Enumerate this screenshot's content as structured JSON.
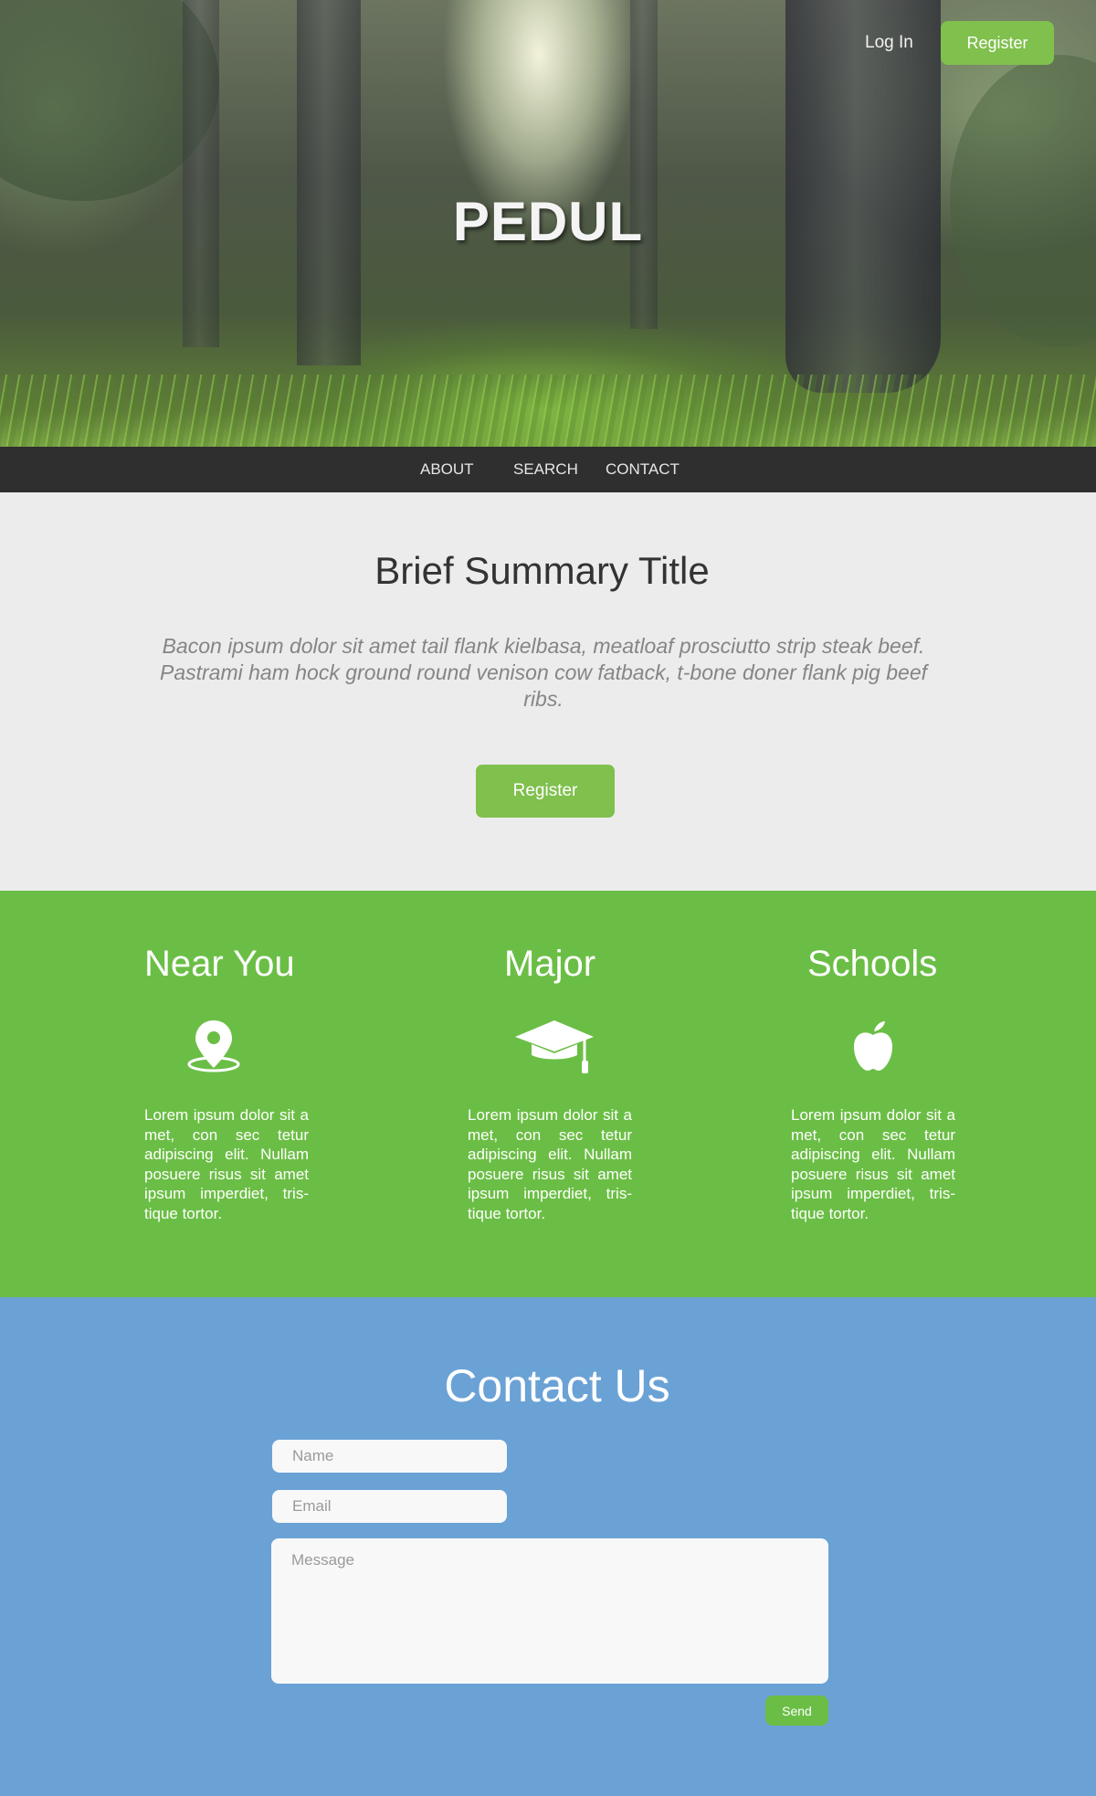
{
  "header": {
    "site_title": "PEDUL",
    "login_label": "Log In",
    "register_label": "Register"
  },
  "nav": {
    "items": [
      {
        "label": "ABOUT"
      },
      {
        "label": "SEARCH"
      },
      {
        "label": "CONTACT"
      }
    ]
  },
  "summary": {
    "title": "Brief Summary Title",
    "body": "Bacon ipsum dolor sit amet tail flank kielbasa, meatloaf prosciutto strip steak beef. Pastrami ham hock ground round venison cow fatback, t-bone doner flank pig beef ribs.",
    "register_label": "Register"
  },
  "features": [
    {
      "title": "Near You",
      "icon": "map-pin-icon",
      "text": "Lorem ipsum dolor sit a met, con sec tetur adipiscing elit. Nullam posuere risus sit amet ipsum imperdiet, tris- tique tortor."
    },
    {
      "title": "Major",
      "icon": "graduation-cap-icon",
      "text": "Lorem ipsum dolor sit a met, con sec tetur adipiscing elit. Nullam posuere risus sit amet ipsum imperdiet, tris- tique tortor."
    },
    {
      "title": "Schools",
      "icon": "apple-icon",
      "text": "Lorem ipsum dolor sit a met, con sec tetur adipiscing elit. Nullam posuere risus sit amet ipsum imperdiet, tris- tique tortor."
    }
  ],
  "contact": {
    "title": "Contact Us",
    "name_placeholder": "Name",
    "email_placeholder": "Email",
    "message_placeholder": "Message",
    "send_label": "Send"
  },
  "colors": {
    "accent_green": "#80c04d",
    "features_green": "#6bbe45",
    "contact_blue": "#6aa2d6",
    "nav_dark": "#2f2f2f",
    "summary_bg": "#ececec"
  }
}
